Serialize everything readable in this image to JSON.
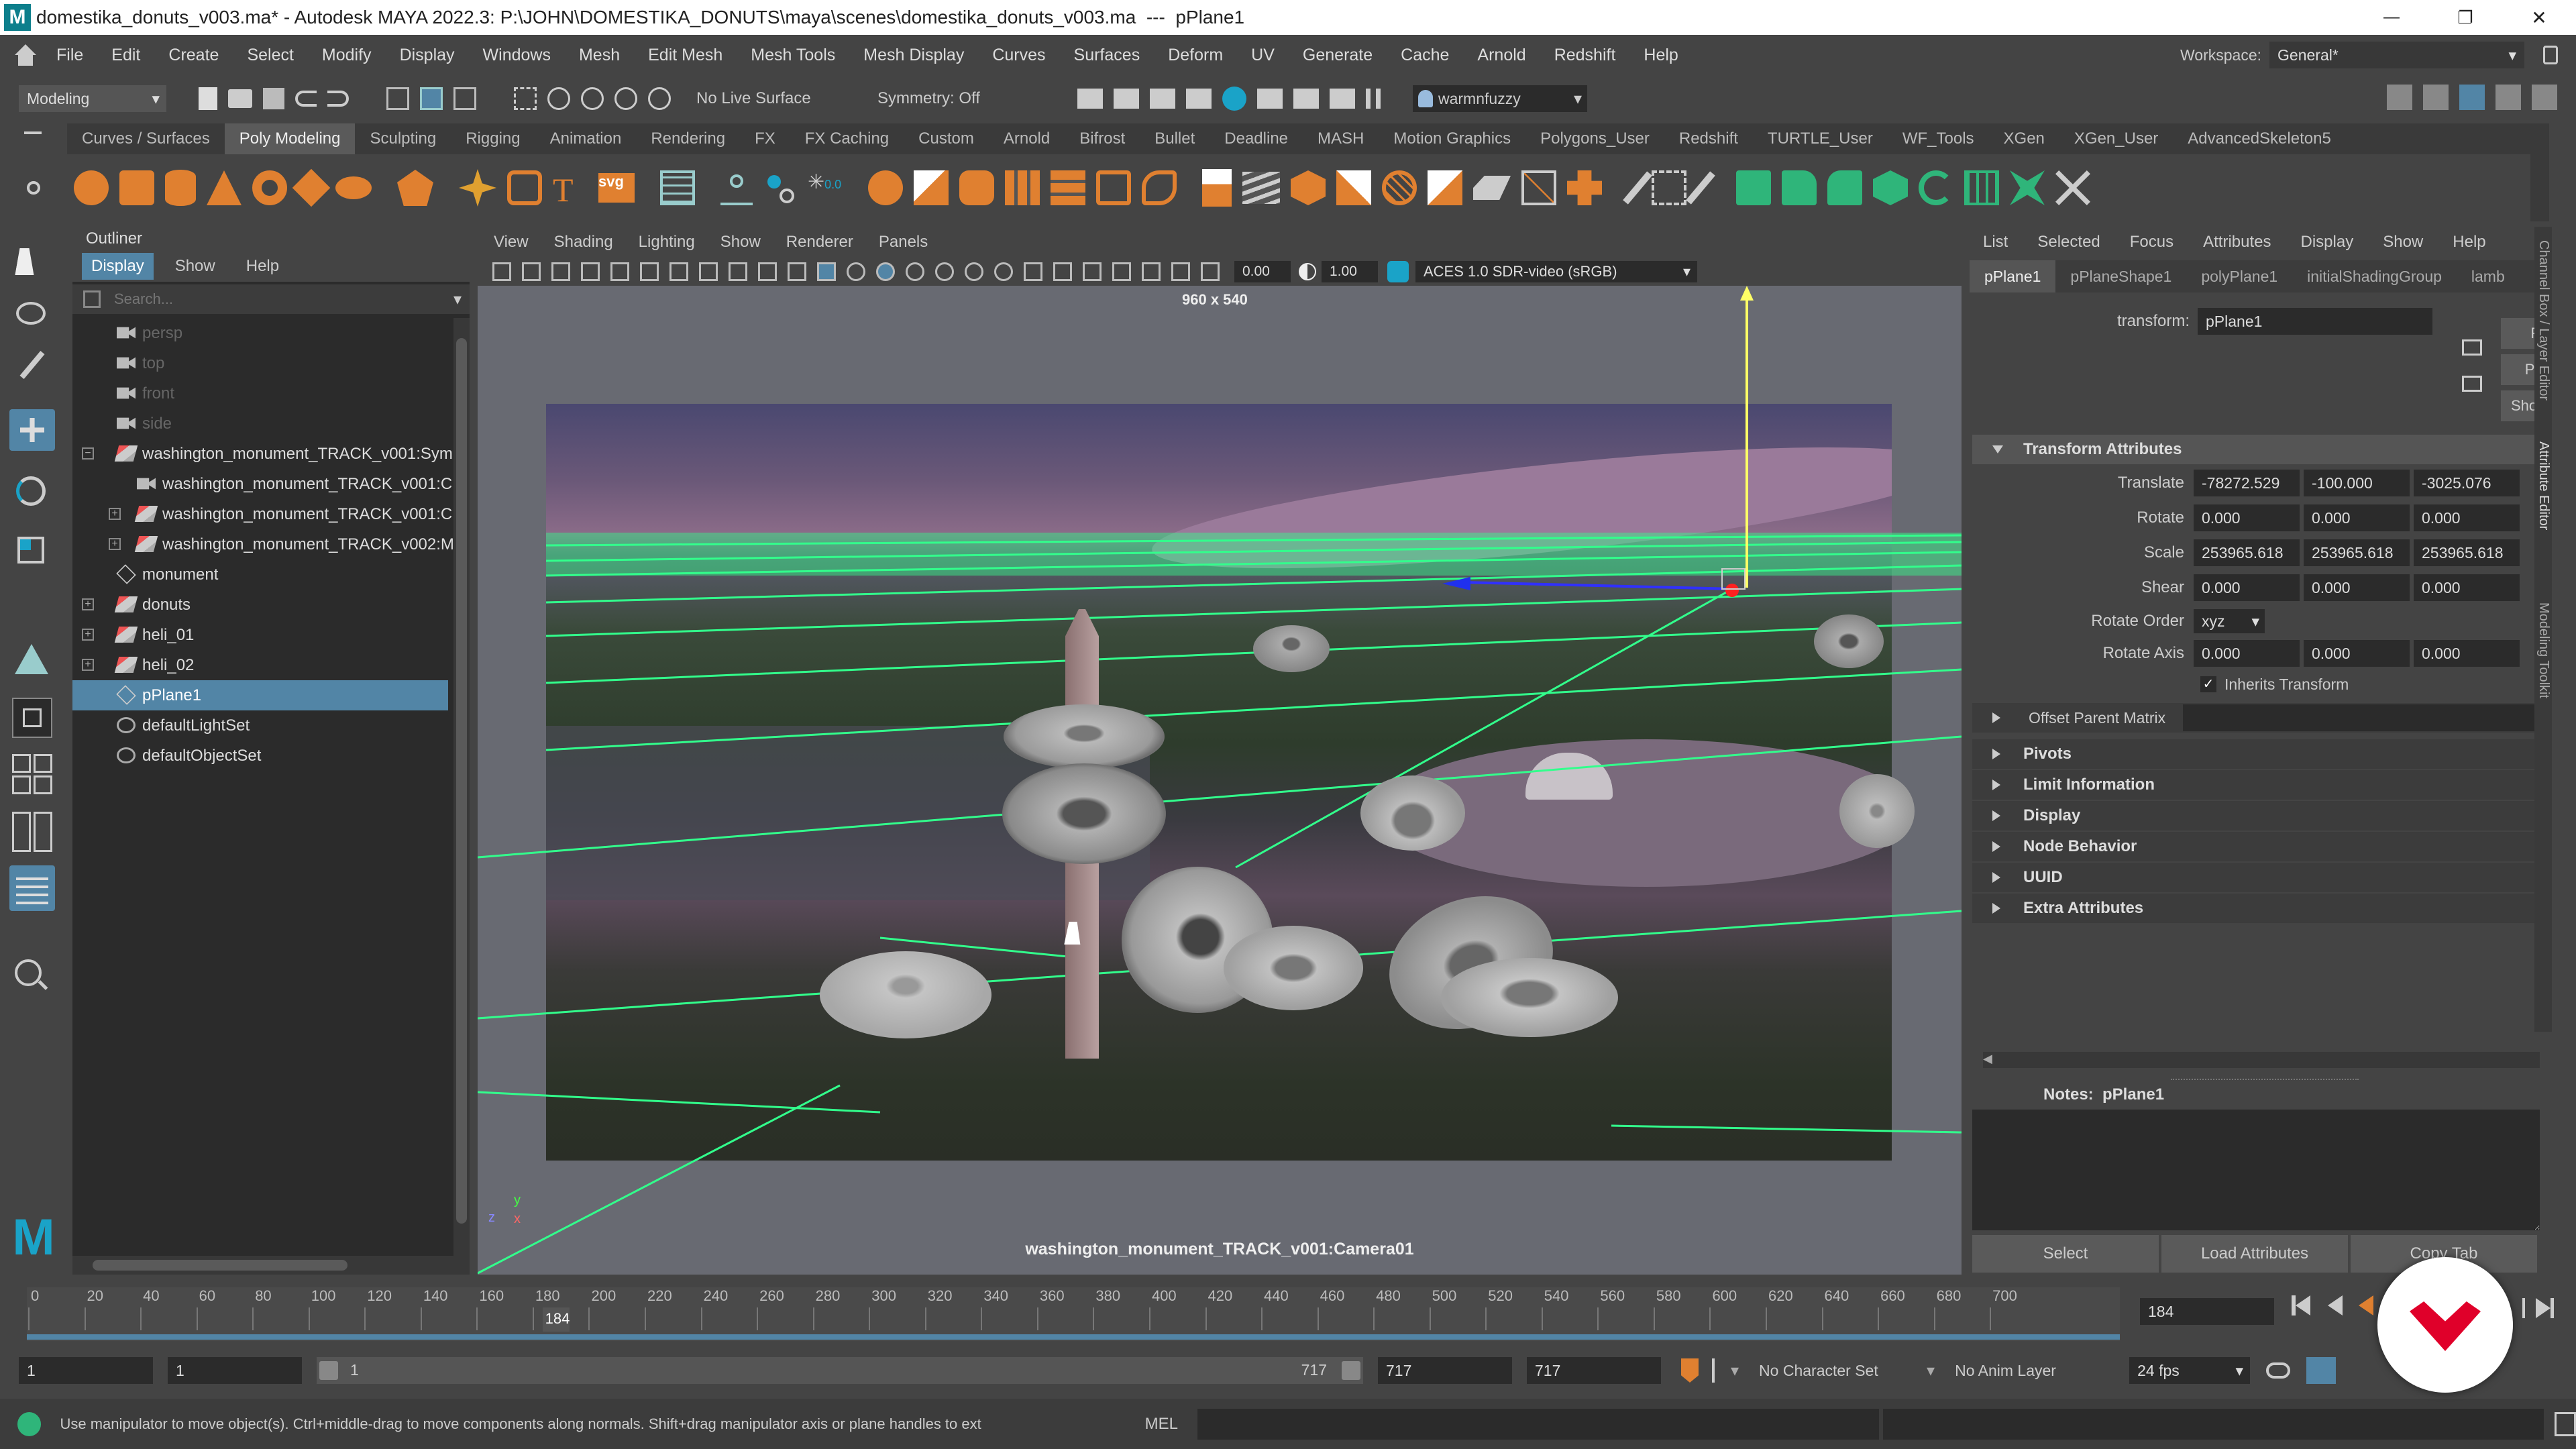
{
  "window": {
    "title": "domestika_donuts_v003.ma* - Autodesk MAYA 2022.3: P:\\JOHN\\DOMESTIKA_DONUTS\\maya\\scenes\\domestika_donuts_v003.ma  ---  pPlane1",
    "minimize": "—",
    "maximize": "❐",
    "close": "✕"
  },
  "menubar": {
    "items": [
      "File",
      "Edit",
      "Create",
      "Select",
      "Modify",
      "Display",
      "Windows",
      "Mesh",
      "Edit Mesh",
      "Mesh Tools",
      "Mesh Display",
      "Curves",
      "Surfaces",
      "Deform",
      "UV",
      "Generate",
      "Cache",
      "Arnold",
      "Redshift",
      "Help"
    ],
    "workspace_label": "Workspace:",
    "workspace_value": "General*"
  },
  "statusline": {
    "mode": "Modeling",
    "live_surface": "No Live Surface",
    "symmetry": "Symmetry: Off",
    "user": "warmnfuzzy"
  },
  "shelf": {
    "tabs": [
      "Curves / Surfaces",
      "Poly Modeling",
      "Sculpting",
      "Rigging",
      "Animation",
      "Rendering",
      "FX",
      "FX Caching",
      "Custom",
      "Arnold",
      "Bifrost",
      "Bullet",
      "Deadline",
      "MASH",
      "Motion Graphics",
      "Polygons_User",
      "Redshift",
      "TURTLE_User",
      "WF_Tools",
      "XGen",
      "XGen_User",
      "AdvancedSkeleton5"
    ],
    "active": "Poly Modeling",
    "icon_labels": {
      "text": "T",
      "svg": "svg",
      "zero": "0.0"
    }
  },
  "outliner": {
    "title": "Outliner",
    "menu": [
      "Display",
      "Show",
      "Help"
    ],
    "search_placeholder": "Search...",
    "items": [
      {
        "label": "persp",
        "indent": 0,
        "icon": "camera-icon",
        "dim": true,
        "expand": false
      },
      {
        "label": "top",
        "indent": 0,
        "icon": "camera-icon",
        "dim": true,
        "expand": false
      },
      {
        "label": "front",
        "indent": 0,
        "icon": "camera-icon",
        "dim": true,
        "expand": false
      },
      {
        "label": "side",
        "indent": 0,
        "icon": "camera-icon",
        "dim": true,
        "expand": false
      },
      {
        "label": "washington_monument_TRACK_v001:Sym",
        "indent": 0,
        "icon": "group-icon",
        "dim": false,
        "expand": "minus"
      },
      {
        "label": "washington_monument_TRACK_v001:C",
        "indent": 1,
        "icon": "camera-icon",
        "dim": false,
        "expand": false
      },
      {
        "label": "washington_monument_TRACK_v001:C",
        "indent": 1,
        "icon": "group-icon",
        "dim": false,
        "expand": "plus"
      },
      {
        "label": "washington_monument_TRACK_v002:M",
        "indent": 1,
        "icon": "group-icon",
        "dim": false,
        "expand": "plus"
      },
      {
        "label": "monument",
        "indent": 0,
        "icon": "mesh-icon",
        "dim": false,
        "expand": false
      },
      {
        "label": "donuts",
        "indent": 0,
        "icon": "group-icon",
        "dim": false,
        "expand": "plus"
      },
      {
        "label": "heli_01",
        "indent": 0,
        "icon": "group-icon",
        "dim": false,
        "expand": "plus"
      },
      {
        "label": "heli_02",
        "indent": 0,
        "icon": "group-icon",
        "dim": false,
        "expand": "plus"
      },
      {
        "label": "pPlane1",
        "indent": 0,
        "icon": "mesh-icon",
        "dim": false,
        "expand": false,
        "selected": true
      },
      {
        "label": "defaultLightSet",
        "indent": 0,
        "icon": "set-icon",
        "dim": false,
        "expand": false
      },
      {
        "label": "defaultObjectSet",
        "indent": 0,
        "icon": "set-icon",
        "dim": false,
        "expand": false
      }
    ]
  },
  "viewport": {
    "menu": [
      "View",
      "Shading",
      "Lighting",
      "Show",
      "Renderer",
      "Panels"
    ],
    "exposure": "0.00",
    "gamma": "1.00",
    "color_space": "ACES 1.0 SDR-video (sRGB)",
    "resolution": "960 x 540",
    "camera": "washington_monument_TRACK_v001:Camera01",
    "axis_y": "y",
    "axis_z": "z",
    "axis_x": "x"
  },
  "attribute_editor": {
    "menu": [
      "List",
      "Selected",
      "Focus",
      "Attributes",
      "Display",
      "Show",
      "Help"
    ],
    "tabs": [
      "pPlane1",
      "pPlaneShape1",
      "polyPlane1",
      "initialShadingGroup",
      "lamb"
    ],
    "side_buttons": [
      "Fo",
      "Pre",
      "Show"
    ],
    "transform_label": "transform:",
    "transform_value": "pPlane1",
    "section_title": "Transform Attributes",
    "rows": [
      {
        "label": "Translate",
        "values": [
          "-78272.529",
          "-100.000",
          "-3025.076"
        ]
      },
      {
        "label": "Rotate",
        "values": [
          "0.000",
          "0.000",
          "0.000"
        ]
      },
      {
        "label": "Scale",
        "values": [
          "253965.618",
          "253965.618",
          "253965.618"
        ]
      },
      {
        "label": "Shear",
        "values": [
          "0.000",
          "0.000",
          "0.000"
        ]
      }
    ],
    "rotate_order_label": "Rotate Order",
    "rotate_order_value": "xyz",
    "rotate_axis": {
      "label": "Rotate Axis",
      "values": [
        "0.000",
        "0.000",
        "0.000"
      ]
    },
    "inherits": "Inherits Transform",
    "offset_parent": "Offset Parent Matrix",
    "sections": [
      "Pivots",
      "Limit Information",
      "Display",
      "Node Behavior",
      "UUID",
      "Extra Attributes"
    ],
    "notes_label": "Notes:  pPlane1",
    "buttons": [
      "Select",
      "Load Attributes",
      "Copy Tab"
    ],
    "side_tabs": [
      "Channel Box / Layer Editor",
      "Attribute Editor",
      "Modeling Toolkit"
    ]
  },
  "timeline": {
    "ticks": [
      "0",
      "20",
      "40",
      "60",
      "80",
      "100",
      "120",
      "140",
      "160",
      "180",
      "200",
      "220",
      "240",
      "260",
      "280",
      "300",
      "320",
      "340",
      "360",
      "380",
      "400",
      "420",
      "440",
      "460",
      "480",
      "500",
      "520",
      "540",
      "560",
      "580",
      "600",
      "620",
      "640",
      "660",
      "680",
      "700"
    ],
    "current_frame": "184",
    "current_frame_field": "184",
    "max_frame": 717
  },
  "range": {
    "start": "1",
    "inner_start": "1",
    "slider_start": "1",
    "slider_end": "717",
    "end": "717",
    "anim_end": "717",
    "char_set": "No Character Set",
    "anim_layer": "No Anim Layer",
    "fps": "24 fps"
  },
  "cmdline": {
    "help": "Use manipulator to move object(s). Ctrl+middle-drag to move components along normals. Shift+drag manipulator axis or plane handles to ext",
    "mel": "MEL"
  },
  "colors": {
    "accent": "#5285a6",
    "grid_green": "#32ff8c",
    "panel_dark": "#2b2b2b",
    "panel": "#444444"
  }
}
